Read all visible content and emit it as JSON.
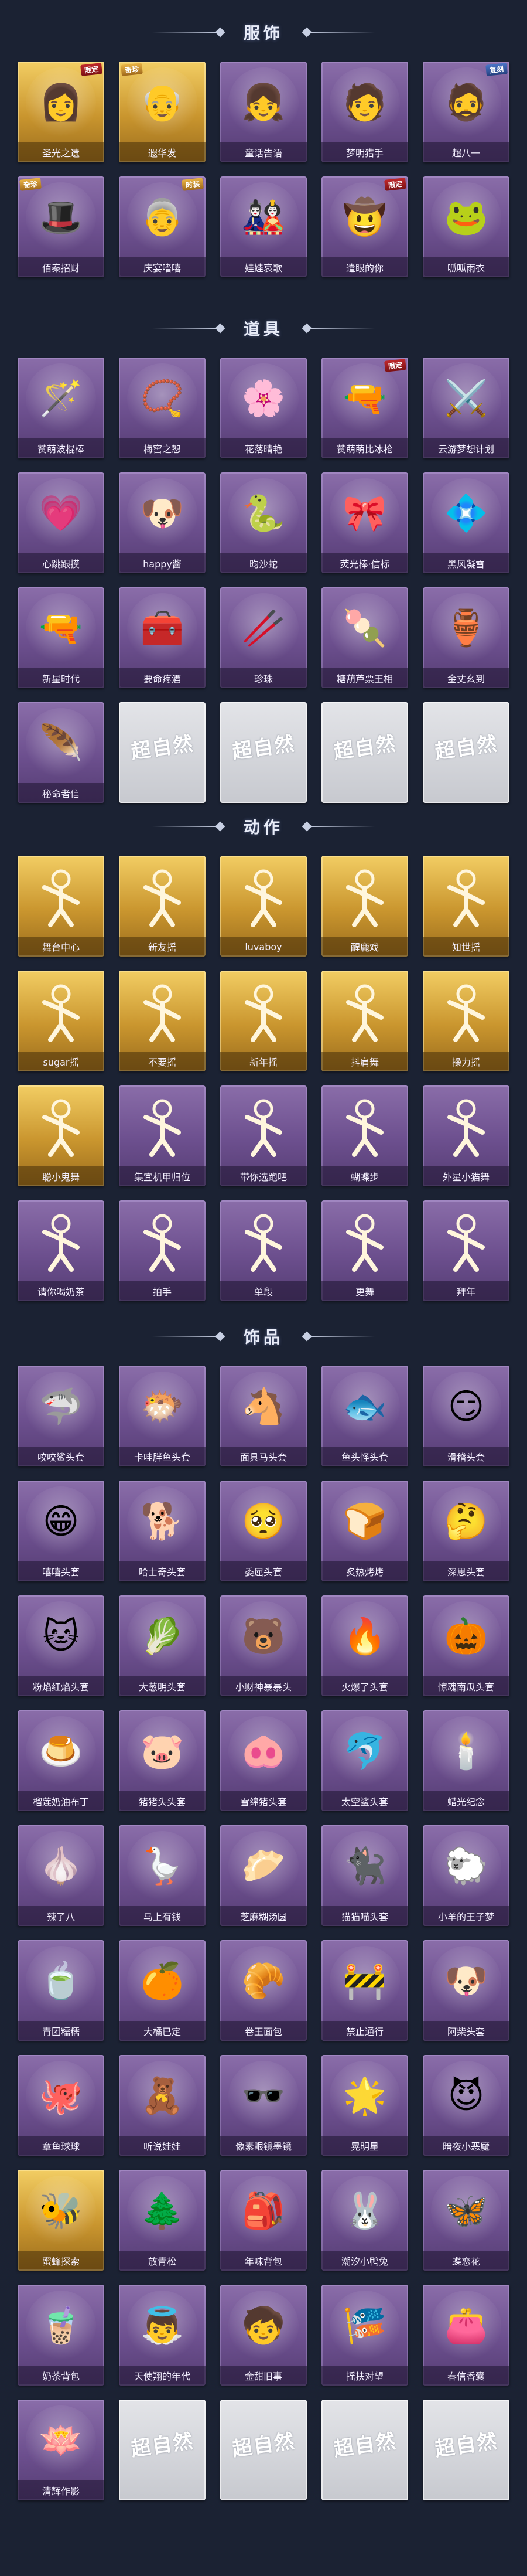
{
  "sections": [
    {
      "title": "服饰",
      "items": [
        {
          "name": "圣光之遗",
          "style": "gold",
          "icon": "👩",
          "tag": "限定",
          "tag_style": "red"
        },
        {
          "name": "遐华发",
          "style": "gold",
          "icon": "👴",
          "tag": "奇珍",
          "tag_style": "gold",
          "tag_side": "left"
        },
        {
          "name": "童话告语",
          "style": "purple",
          "icon": "👧"
        },
        {
          "name": "梦明猎手",
          "style": "purple",
          "icon": "🧑"
        },
        {
          "name": "超八一",
          "style": "purple",
          "icon": "🧔",
          "tag": "复刻",
          "tag_style": "blue"
        },
        {
          "name": "佰秦招财",
          "style": "purple",
          "icon": "🎩",
          "tag": "奇珍",
          "tag_style": "gold",
          "tag_side": "left"
        },
        {
          "name": "庆宴嗜嘻",
          "style": "purple",
          "icon": "👵",
          "tag": "时装",
          "tag_style": "gold"
        },
        {
          "name": "娃娃哀歌",
          "style": "purple",
          "icon": "🎎"
        },
        {
          "name": "遣眼的你",
          "style": "purple",
          "icon": "🤠",
          "tag": "限定",
          "tag_style": "red"
        },
        {
          "name": "呱呱雨衣",
          "style": "purple",
          "icon": "🐸"
        }
      ]
    },
    {
      "title": "道具",
      "items": [
        {
          "name": "赞萌波棍棒",
          "style": "purple",
          "icon": "🪄"
        },
        {
          "name": "梅窖之恕",
          "style": "purple",
          "icon": "📿"
        },
        {
          "name": "花落晴艳",
          "style": "purple",
          "icon": "🌸"
        },
        {
          "name": "赞萌萌比冰枪",
          "style": "purple",
          "icon": "🔫",
          "tag": "限定",
          "tag_style": "red"
        },
        {
          "name": "云游梦想计划",
          "style": "purple",
          "icon": "⚔️"
        },
        {
          "name": "心跳跟摸",
          "style": "purple",
          "icon": "💗"
        },
        {
          "name": "happy酱",
          "style": "purple",
          "icon": "🐶"
        },
        {
          "name": "昀沙蛇",
          "style": "purple",
          "icon": "🐍"
        },
        {
          "name": "荧光棒·信标",
          "style": "purple",
          "icon": "🎀"
        },
        {
          "name": "黑风凝雪",
          "style": "purple",
          "icon": "💠"
        },
        {
          "name": "新星时代",
          "style": "purple",
          "icon": "🔫"
        },
        {
          "name": "要命疼酒",
          "style": "purple",
          "icon": "🧰"
        },
        {
          "name": "珍珠",
          "style": "purple",
          "icon": "🥢"
        },
        {
          "name": "糖葫芦票王相",
          "style": "purple",
          "icon": "🍡"
        },
        {
          "name": "金丈幺到",
          "style": "purple",
          "icon": "🏺"
        },
        {
          "name": "秘命者信",
          "style": "purple",
          "icon": "🪶"
        },
        {
          "name": "",
          "style": "placeholder"
        },
        {
          "name": "",
          "style": "placeholder"
        },
        {
          "name": "",
          "style": "placeholder"
        },
        {
          "name": "",
          "style": "placeholder"
        }
      ]
    },
    {
      "title": "动作",
      "items": [
        {
          "name": "舞台中心",
          "style": "gold",
          "icon": "pose"
        },
        {
          "name": "新友摇",
          "style": "gold",
          "icon": "pose"
        },
        {
          "name": "luvaboy",
          "style": "gold",
          "icon": "pose"
        },
        {
          "name": "醒鹿戏",
          "style": "gold",
          "icon": "pose"
        },
        {
          "name": "知世摇",
          "style": "gold",
          "icon": "pose"
        },
        {
          "name": "sugar摇",
          "style": "gold",
          "icon": "pose"
        },
        {
          "name": "不要摇",
          "style": "gold",
          "icon": "pose"
        },
        {
          "name": "新年摇",
          "style": "gold",
          "icon": "pose"
        },
        {
          "name": "抖肩舞",
          "style": "gold",
          "icon": "pose"
        },
        {
          "name": "操力摇",
          "style": "gold",
          "icon": "pose"
        },
        {
          "name": "聪小鬼舞",
          "style": "gold",
          "icon": "pose"
        },
        {
          "name": "集宜机甲归位",
          "style": "purple",
          "icon": "pose"
        },
        {
          "name": "带你选跑吧",
          "style": "purple",
          "icon": "pose"
        },
        {
          "name": "蝴蝶步",
          "style": "purple",
          "icon": "pose"
        },
        {
          "name": "外星小猫舞",
          "style": "purple",
          "icon": "pose"
        },
        {
          "name": "请你喝奶茶",
          "style": "purple",
          "icon": "pose"
        },
        {
          "name": "拍手",
          "style": "purple",
          "icon": "pose"
        },
        {
          "name": "单段",
          "style": "purple",
          "icon": "pose"
        },
        {
          "name": "更舞",
          "style": "purple",
          "icon": "pose"
        },
        {
          "name": "拜年",
          "style": "purple",
          "icon": "pose"
        }
      ]
    },
    {
      "title": "饰品",
      "items": [
        {
          "name": "咬咬鲨头套",
          "style": "purple",
          "icon": "🦈"
        },
        {
          "name": "卡哇胖鱼头套",
          "style": "purple",
          "icon": "🐡"
        },
        {
          "name": "面具马头套",
          "style": "purple",
          "icon": "🐴"
        },
        {
          "name": "鱼头怪头套",
          "style": "purple",
          "icon": "🐟"
        },
        {
          "name": "滑稽头套",
          "style": "purple",
          "icon": "😏"
        },
        {
          "name": "嘻嘻头套",
          "style": "purple",
          "icon": "😁"
        },
        {
          "name": "哈士奇头套",
          "style": "purple",
          "icon": "🐕"
        },
        {
          "name": "委屈头套",
          "style": "purple",
          "icon": "🥺"
        },
        {
          "name": "炙热烤烤",
          "style": "purple",
          "icon": "🍞"
        },
        {
          "name": "深思头套",
          "style": "purple",
          "icon": "🤔"
        },
        {
          "name": "粉焰红焰头套",
          "style": "purple",
          "icon": "🐱"
        },
        {
          "name": "大葱明头套",
          "style": "purple",
          "icon": "🥬"
        },
        {
          "name": "小财神暴暴头",
          "style": "purple",
          "icon": "🐻"
        },
        {
          "name": "火爆了头套",
          "style": "purple",
          "icon": "🔥"
        },
        {
          "name": "惊魂南瓜头套",
          "style": "purple",
          "icon": "🎃"
        },
        {
          "name": "榴莲奶油布丁",
          "style": "purple",
          "icon": "🍮"
        },
        {
          "name": "猪猪头头套",
          "style": "purple",
          "icon": "🐷"
        },
        {
          "name": "雪绵猪头套",
          "style": "purple",
          "icon": "🐽"
        },
        {
          "name": "太空鲨头套",
          "style": "purple",
          "icon": "🐬"
        },
        {
          "name": "蜡光纪念",
          "style": "purple",
          "icon": "🕯️"
        },
        {
          "name": "辣了八",
          "style": "purple",
          "icon": "🧄"
        },
        {
          "name": "马上有钱",
          "style": "purple",
          "icon": "🪿"
        },
        {
          "name": "芝麻糊汤圆",
          "style": "purple",
          "icon": "🥟"
        },
        {
          "name": "猫猫喵头套",
          "style": "purple",
          "icon": "🐈‍⬛"
        },
        {
          "name": "小羊的王子梦",
          "style": "purple",
          "icon": "🐑"
        },
        {
          "name": "青团糯糯",
          "style": "purple",
          "icon": "🍵"
        },
        {
          "name": "大橘已定",
          "style": "purple",
          "icon": "🍊"
        },
        {
          "name": "卷王面包",
          "style": "purple",
          "icon": "🥐"
        },
        {
          "name": "禁止通行",
          "style": "purple",
          "icon": "🚧"
        },
        {
          "name": "阿柴头套",
          "style": "purple",
          "icon": "🐶"
        },
        {
          "name": "章鱼球球",
          "style": "purple",
          "icon": "🐙"
        },
        {
          "name": "听说娃娃",
          "style": "purple",
          "icon": "🧸"
        },
        {
          "name": "像素眼镜墨镜",
          "style": "purple",
          "icon": "🕶️"
        },
        {
          "name": "晃明星",
          "style": "purple",
          "icon": "🌟"
        },
        {
          "name": "暗夜小恶魔",
          "style": "purple",
          "icon": "😈"
        },
        {
          "name": "蜜蜂探索",
          "style": "gold",
          "icon": "🐝"
        },
        {
          "name": "放青松",
          "style": "purple",
          "icon": "🌲"
        },
        {
          "name": "年味背包",
          "style": "purple",
          "icon": "🎒"
        },
        {
          "name": "潮汐小鸭兔",
          "style": "purple",
          "icon": "🐰"
        },
        {
          "name": "蝶恋花",
          "style": "purple",
          "icon": "🦋"
        },
        {
          "name": "奶茶背包",
          "style": "purple",
          "icon": "🧋"
        },
        {
          "name": "天使翔的年代",
          "style": "purple",
          "icon": "👼"
        },
        {
          "name": "金甜旧事",
          "style": "purple",
          "icon": "🧒"
        },
        {
          "name": "摇扶对望",
          "style": "purple",
          "icon": "🎏"
        },
        {
          "name": "春信香囊",
          "style": "purple",
          "icon": "👛"
        },
        {
          "name": "清辉作影",
          "style": "purple",
          "icon": "🪷"
        },
        {
          "name": "",
          "style": "placeholder"
        },
        {
          "name": "",
          "style": "placeholder"
        },
        {
          "name": "",
          "style": "placeholder"
        },
        {
          "name": "",
          "style": "placeholder"
        }
      ]
    }
  ],
  "placeholder_text": "超自然"
}
